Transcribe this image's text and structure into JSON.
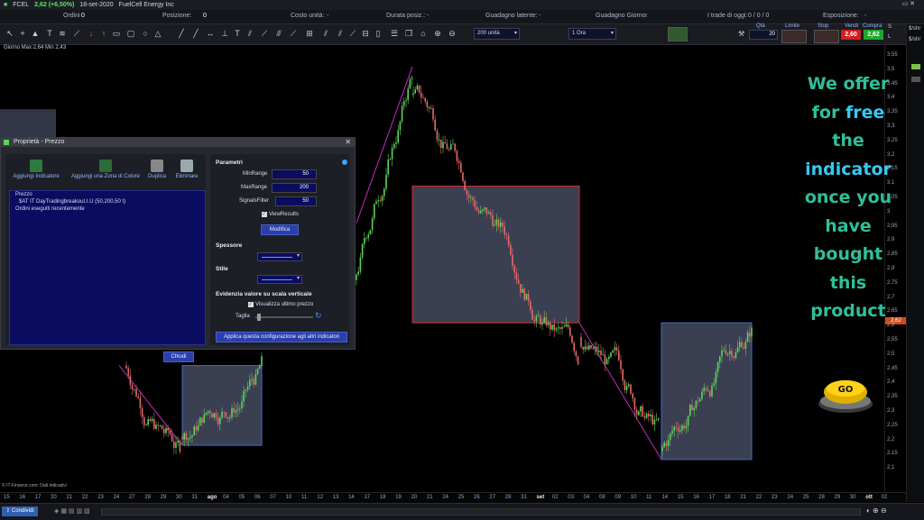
{
  "topbar": {
    "symbol": "FCEL",
    "quote": "2,62 (+6,50%)",
    "date": "18-set-2020",
    "company": "FuelCell Energy Inc"
  },
  "infobar": {
    "ordini": "Ordini",
    "ordini_val": "0",
    "posizione": "Posizione:",
    "posizione_val": "0",
    "costo": "Costo unità:",
    "costo_val": "-",
    "durata": "Durata posiz.:",
    "durata_val": "-",
    "guadagno_latente": "Guadagno latente:",
    "guadagno_latente_val": "-",
    "guadagno_giorno": "Guadagno Giorno:",
    "guadagno_giorno_val": "-",
    "trade_oggi": "I trade di oggi:",
    "trade_oggi_val": "0 / 0 / 0",
    "esposizione": "Esposizione:",
    "esposizione_val": "-"
  },
  "toolbar": {
    "units": "200 unità",
    "timeframe": "1 Ora",
    "qta_label": "Qtà",
    "qta_value": "20",
    "limite": "Limite",
    "stop": "Stop",
    "vendi_label": "Vendi",
    "vendi_price": "2,60",
    "compra_label": "Compra",
    "compra_price": "2,62",
    "share_s": "S",
    "share_l": "L",
    "shr": "$/shr"
  },
  "chart": {
    "info": "Giorno Max 2,64 Min 2,43",
    "credit": "© IT-Finance.com: Dati indicativi",
    "price_tag": "2,62",
    "y_ticks": [
      "3,55",
      "3,5",
      "3,45",
      "3,4",
      "3,35",
      "3,3",
      "3,25",
      "3,2",
      "3,15",
      "3,1",
      "3,05",
      "3",
      "2,95",
      "2,9",
      "2,85",
      "2,8",
      "2,75",
      "2,7",
      "2,65",
      "2,6",
      "2,55",
      "2,5",
      "2,45",
      "2,4",
      "2,35",
      "2,3",
      "2,25",
      "2,2",
      "2,15",
      "2,1"
    ],
    "x_ticks": [
      "15",
      "16",
      "17",
      "20",
      "21",
      "22",
      "23",
      "24",
      "27",
      "28",
      "29",
      "30",
      "31",
      "ago",
      "04",
      "05",
      "06",
      "07",
      "10",
      "11",
      "12",
      "13",
      "14",
      "17",
      "18",
      "19",
      "20",
      "21",
      "24",
      "25",
      "26",
      "27",
      "28",
      "31",
      "set",
      "02",
      "03",
      "04",
      "08",
      "09",
      "10",
      "11",
      "14",
      "15",
      "16",
      "17",
      "18",
      "21",
      "22",
      "23",
      "24",
      "25",
      "28",
      "29",
      "30",
      "ott",
      "02"
    ]
  },
  "dialog": {
    "title": "Proprietà - Prezzo",
    "add_indicator": "Aggiungi Indicatore",
    "add_zone": "Aggiungi una Zona di Colore",
    "duplicate": "Duplica",
    "delete": "Eliminare",
    "tree": [
      "Prezzo",
      "$AT IT DayTradingbreakout.I.U (50,200,50 t)",
      "Ordini eseguiti recentemente"
    ],
    "parametri": "Parametri",
    "minrange_label": "MinRange",
    "minrange": "50",
    "maxrange_label": "MaxRange",
    "maxrange": "200",
    "signals_label": "SignalsFilter",
    "signals": "50",
    "viewresults": "ViewResults",
    "modifica": "Modifica",
    "spessore": "Spessore",
    "stile": "Stile",
    "evidenzia": "Evidenzia valore su scala verticale",
    "visualizza": "Visualizza ultimo prezzo",
    "taglia": "Taglia",
    "applica": "Applica questa configurazione agli altri indicatori",
    "chiudi": "Chiudi"
  },
  "promo": {
    "line1": "We offer",
    "line2a": "for ",
    "line2b": "free",
    "line3": "the",
    "line4": "indicator",
    "line5": "once you",
    "line6": "have",
    "line7": "bought",
    "line8": "this",
    "line9": "product",
    "go": "GO"
  },
  "statusbar": {
    "condividi": "Condividi"
  },
  "colors": {
    "bull": "#5fd35a",
    "bear": "#e06a6a",
    "box_fill": "#3a3f52",
    "box_red": "#d23030",
    "box_blue": "#3a6fd0",
    "promo_teal": "#2fbf99",
    "promo_cyan": "#38c8f0"
  }
}
